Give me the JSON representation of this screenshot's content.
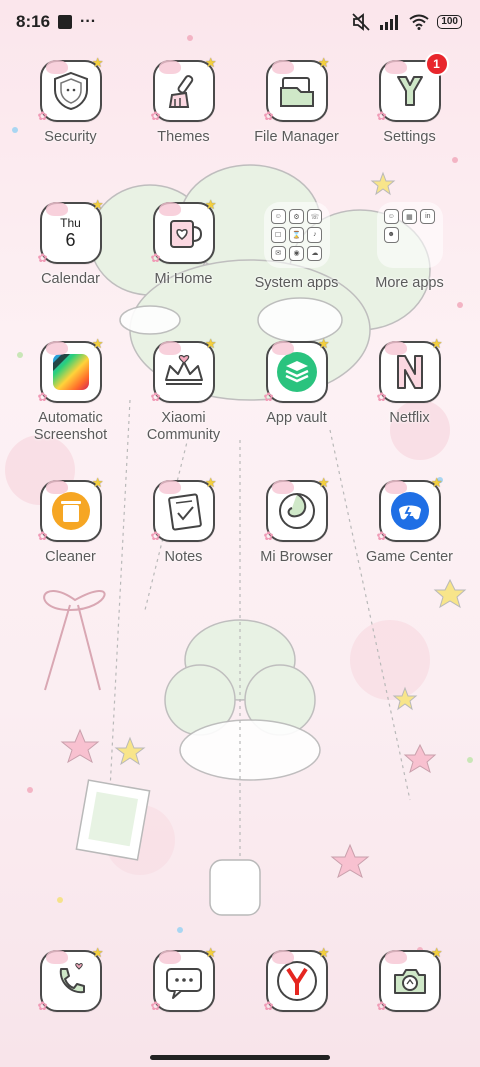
{
  "status_bar": {
    "time": "8:16",
    "more": "···",
    "battery": "100"
  },
  "apps": [
    {
      "label": "Security",
      "icon": "shield-cat-icon"
    },
    {
      "label": "Themes",
      "icon": "paintbrush-icon"
    },
    {
      "label": "File Manager",
      "icon": "folder-icon"
    },
    {
      "label": "Settings",
      "icon": "gear-icon",
      "badge": "1"
    },
    {
      "label": "Calendar",
      "icon": "calendar-icon",
      "day": "Thu",
      "date": "6"
    },
    {
      "label": "Mi Home",
      "icon": "mug-heart-icon"
    },
    {
      "label": "System apps",
      "icon": "folder-grid-icon"
    },
    {
      "label": "More apps",
      "icon": "folder-grid-icon"
    },
    {
      "label": "Automatic Screenshot",
      "line1": "Automatic",
      "line2": "Screenshot",
      "icon": "rainbow-square-icon"
    },
    {
      "label": "Xiaomi Community",
      "line1": "Xiaomi",
      "line2": "Community",
      "icon": "crown-icon"
    },
    {
      "label": "App vault",
      "icon": "layers-icon"
    },
    {
      "label": "Netflix",
      "icon": "netflix-n-icon"
    },
    {
      "label": "Cleaner",
      "icon": "trash-can-icon"
    },
    {
      "label": "Notes",
      "icon": "notepad-icon"
    },
    {
      "label": "Mi Browser",
      "icon": "swirl-icon"
    },
    {
      "label": "Game Center",
      "icon": "game-controller-icon"
    }
  ],
  "system_folder_minis": [
    "☺",
    "⚙",
    "☏",
    "☐",
    "⌛",
    "♪",
    "✉",
    "◉",
    "☁"
  ],
  "more_folder_minis": [
    "☺",
    "▦",
    "in",
    "☻"
  ],
  "dock": [
    {
      "name": "phone",
      "icon": "phone-icon"
    },
    {
      "name": "messages",
      "icon": "message-bubble-icon"
    },
    {
      "name": "yandex-browser",
      "icon": "yandex-y-icon"
    },
    {
      "name": "camera",
      "icon": "camera-icon"
    }
  ],
  "colors": {
    "tile_border": "#4a4a4a",
    "badge": "#e8262c",
    "star": "#f3cf3e",
    "accent_pink": "#f6c6d3"
  }
}
